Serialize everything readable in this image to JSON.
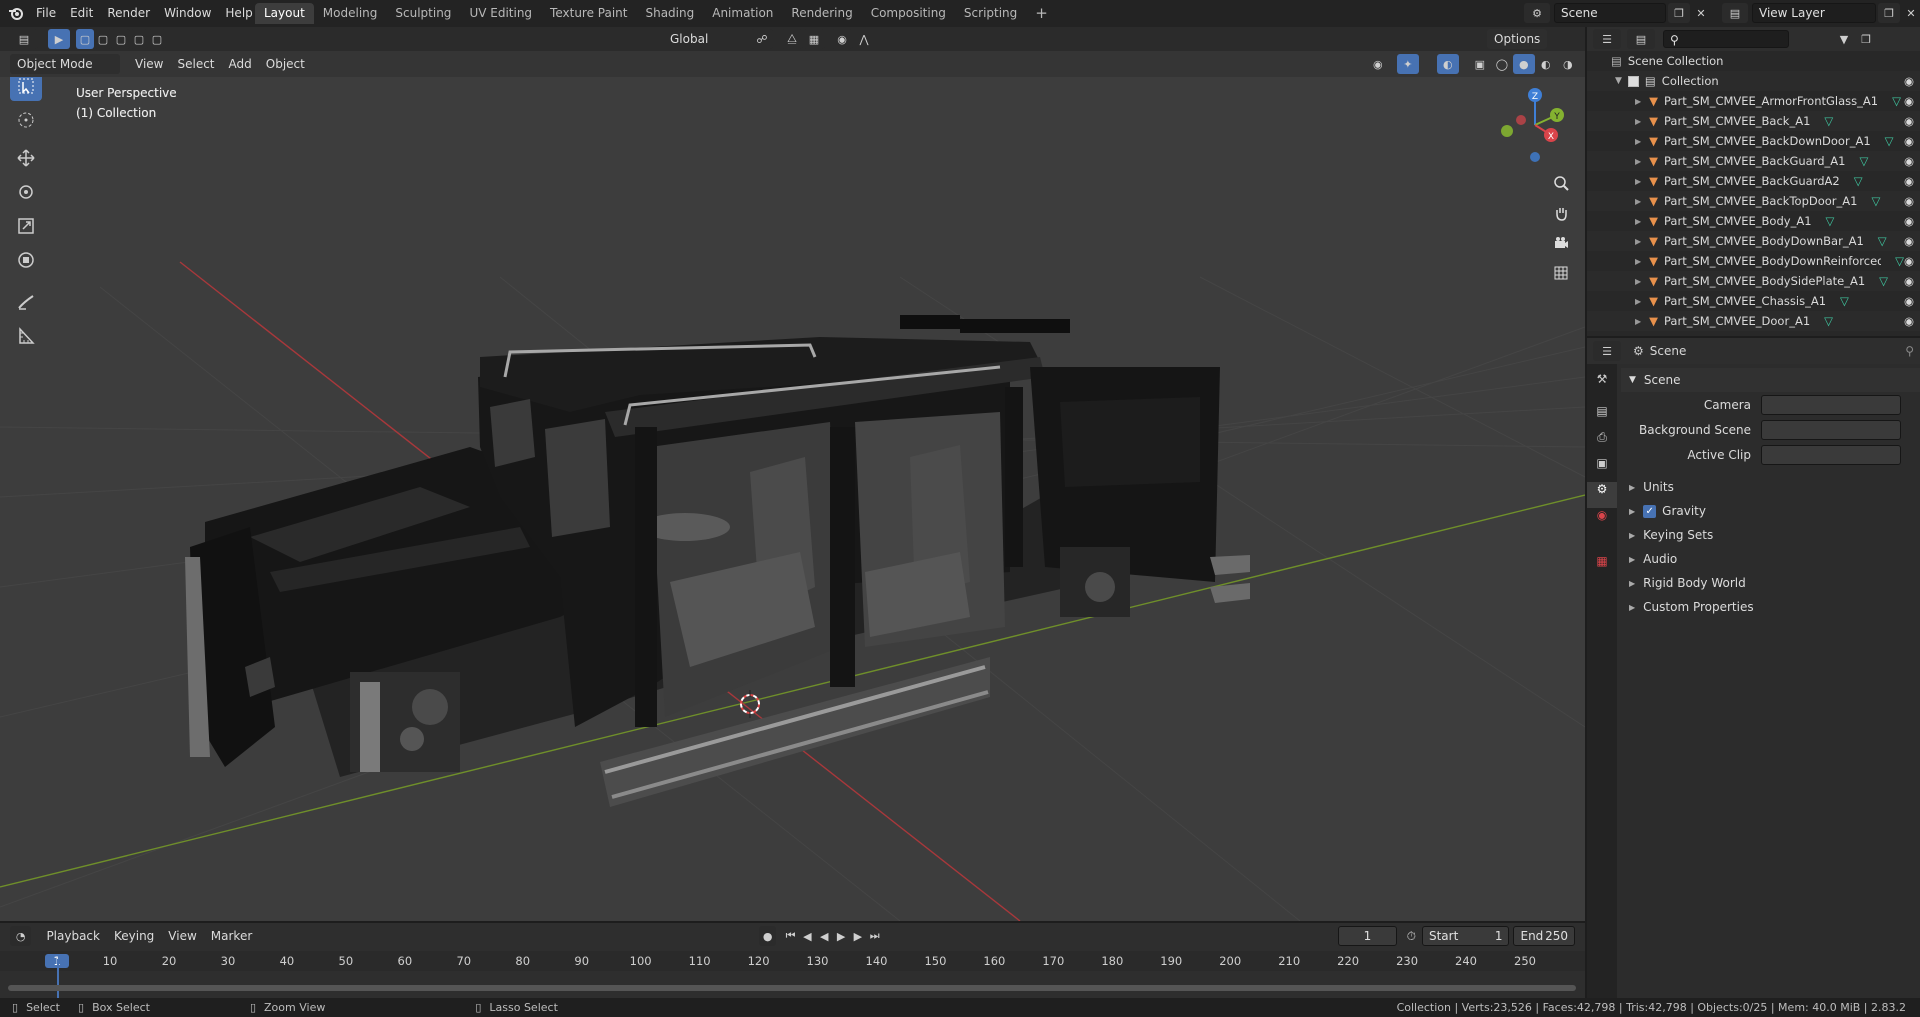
{
  "topbar": {
    "menus": [
      "File",
      "Edit",
      "Render",
      "Window",
      "Help"
    ],
    "workspaces": [
      "Layout",
      "Modeling",
      "Sculpting",
      "UV Editing",
      "Texture Paint",
      "Shading",
      "Animation",
      "Rendering",
      "Compositing",
      "Scripting"
    ],
    "add_tab": "+",
    "scene_name": "Scene",
    "view_layer": "View Layer"
  },
  "viewport": {
    "mode": "Object Mode",
    "menus": [
      "View",
      "Select",
      "Add",
      "Object"
    ],
    "transform_orientation": "Global",
    "options_label": "Options",
    "overlay_title": "User Perspective",
    "overlay_collection": "(1) Collection",
    "gizmo_axes": [
      "Z",
      "Y",
      "X"
    ]
  },
  "outliner": {
    "search_placeholder": "",
    "scene_collection": "Scene Collection",
    "collection": "Collection",
    "items": [
      "Part_SM_CMVEE_ArmorFrontGlass_A1",
      "Part_SM_CMVEE_Back_A1",
      "Part_SM_CMVEE_BackDownDoor_A1",
      "Part_SM_CMVEE_BackGuard_A1",
      "Part_SM_CMVEE_BackGuardA2",
      "Part_SM_CMVEE_BackTopDoor_A1",
      "Part_SM_CMVEE_Body_A1",
      "Part_SM_CMVEE_BodyDownBar_A1",
      "Part_SM_CMVEE_BodyDownReinforcedBar_A",
      "Part_SM_CMVEE_BodySidePlate_A1",
      "Part_SM_CMVEE_Chassis_A1",
      "Part_SM_CMVEE_Door_A1"
    ]
  },
  "properties": {
    "context": "Scene",
    "panel_title": "Scene",
    "fields": [
      {
        "label": "Camera",
        "value": ""
      },
      {
        "label": "Background Scene",
        "value": ""
      },
      {
        "label": "Active Clip",
        "value": ""
      }
    ],
    "sections": [
      "Units",
      "Gravity",
      "Keying Sets",
      "Audio",
      "Rigid Body World",
      "Custom Properties"
    ],
    "gravity_checked": true
  },
  "timeline": {
    "menus": [
      "Playback",
      "Keying",
      "View",
      "Marker"
    ],
    "current_frame": "1",
    "start_label": "Start",
    "start_value": "1",
    "end_label": "End",
    "end_value": "250",
    "ruler_labels": [
      "1",
      "10",
      "20",
      "30",
      "40",
      "50",
      "60",
      "70",
      "80",
      "90",
      "100",
      "110",
      "120",
      "130",
      "140",
      "150",
      "160",
      "170",
      "180",
      "190",
      "200",
      "210",
      "220",
      "230",
      "240",
      "250"
    ]
  },
  "statusbar": {
    "select": "Select",
    "box_select": "Box Select",
    "zoom_view": "Zoom View",
    "lasso_select": "Lasso Select",
    "stats": "Collection | Verts:23,526 | Faces:42,798 | Tris:42,798 | Objects:0/25 | Mem: 40.0 MiB | 2.83.2"
  },
  "colors": {
    "accent": "#4772b3",
    "x_axis": "#d9444a",
    "y_axis": "#84b230",
    "z_axis": "#3f7fd6",
    "mesh_icon": "#e8914c",
    "tri_icon": "#3fc7a0"
  }
}
